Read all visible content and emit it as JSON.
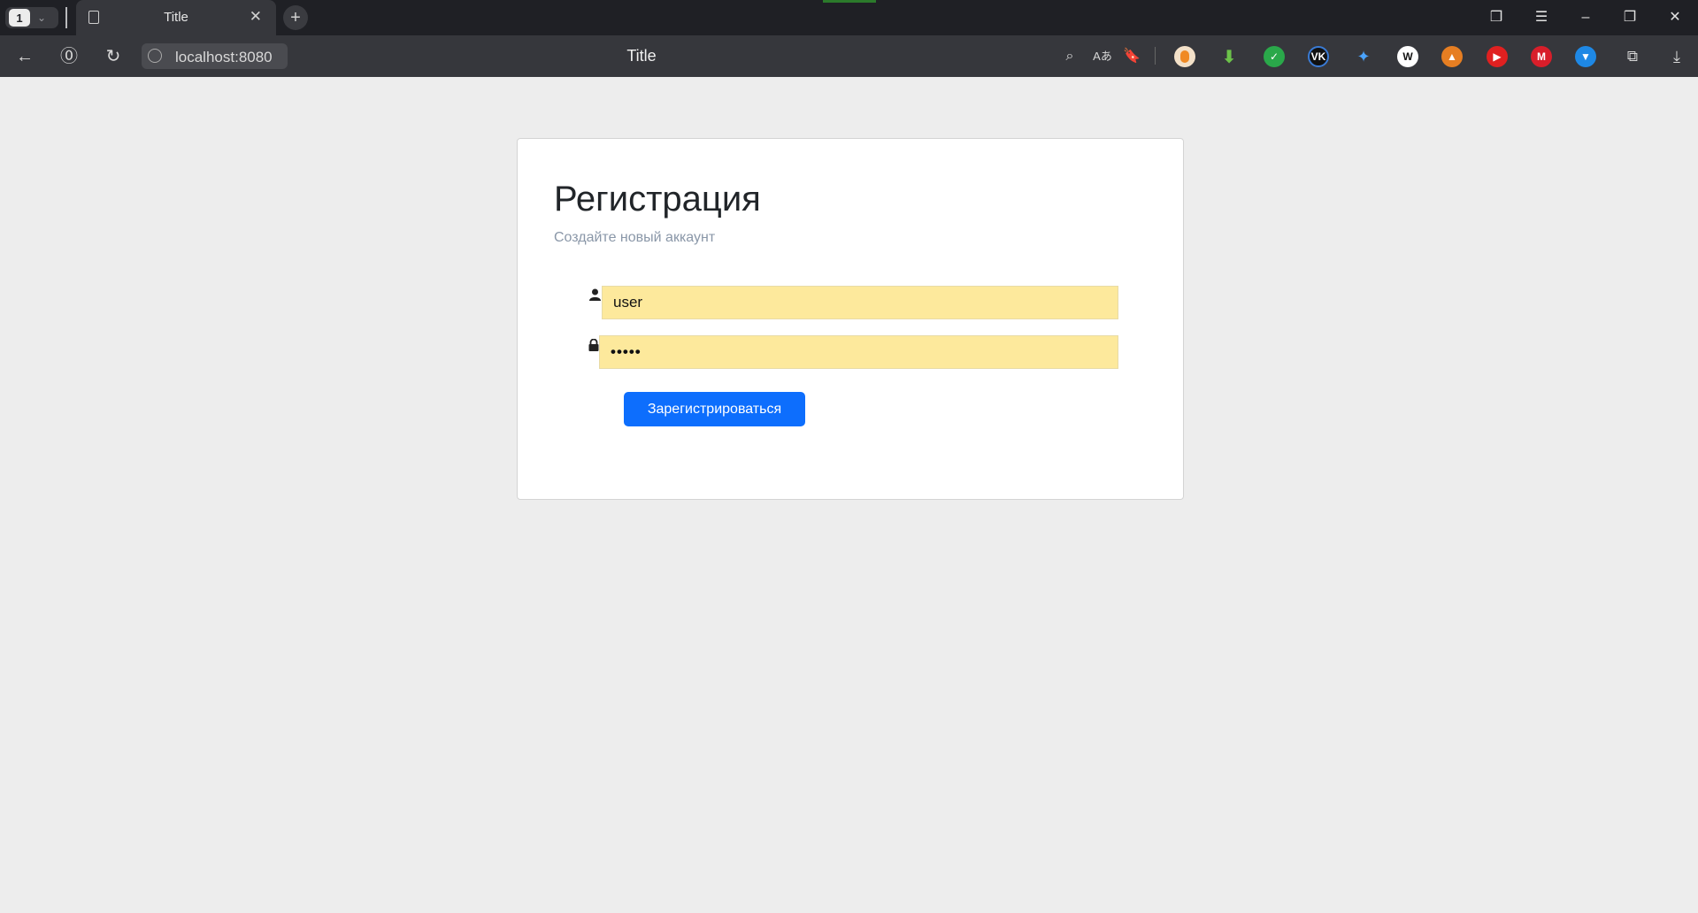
{
  "browser": {
    "tab_count": "1",
    "tab_title": "Title",
    "url": "localhost:8080",
    "page_title": "Title"
  },
  "form": {
    "heading": "Регистрация",
    "subtitle": "Создайте новый аккаунт",
    "username_value": "user",
    "password_value": "•••••",
    "submit_label": "Зарегистрироваться"
  },
  "icons": {
    "user": "user-icon",
    "lock": "lock-icon"
  },
  "colors": {
    "button": "#0d6efd",
    "autofill": "#fde99c",
    "background": "#ededed"
  }
}
